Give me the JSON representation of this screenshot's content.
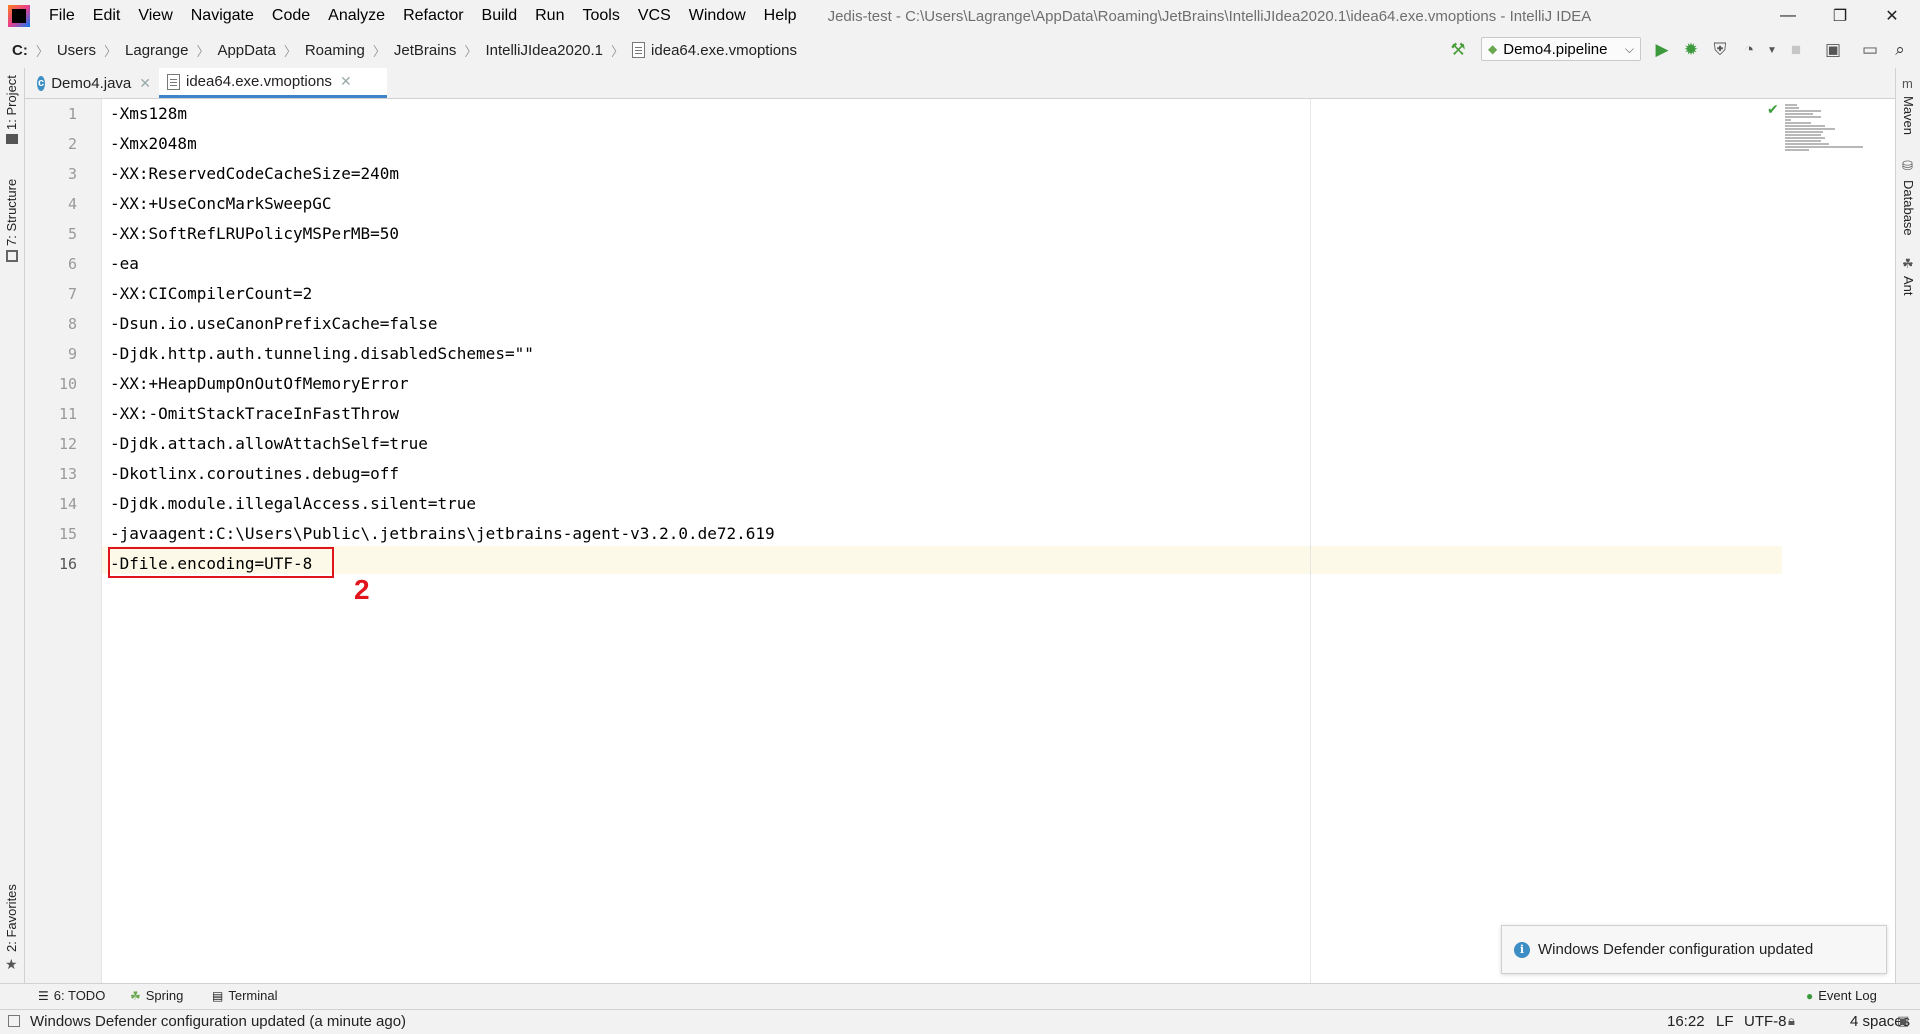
{
  "menu": {
    "items": [
      "File",
      "Edit",
      "View",
      "Navigate",
      "Code",
      "Analyze",
      "Refactor",
      "Build",
      "Run",
      "Tools",
      "VCS",
      "Window",
      "Help"
    ],
    "window_title": "Jedis-test - C:\\Users\\Lagrange\\AppData\\Roaming\\JetBrains\\IntelliJIdea2020.1\\idea64.exe.vmoptions - IntelliJ IDEA"
  },
  "breadcrumbs": [
    "C:",
    "Users",
    "Lagrange",
    "AppData",
    "Roaming",
    "JetBrains",
    "IntelliJIdea2020.1",
    "idea64.exe.vmoptions"
  ],
  "run_config": "Demo4.pipeline",
  "left_tools": [
    "1: Project",
    "7: Structure",
    "2: Favorites"
  ],
  "right_tools": [
    "Maven",
    "Database",
    "Ant"
  ],
  "tabs": [
    {
      "label": "Demo4.java",
      "icon": "java-class-icon",
      "active": false
    },
    {
      "label": "idea64.exe.vmoptions",
      "icon": "text-file-icon",
      "active": true
    }
  ],
  "editor": {
    "lines": [
      "-Xms128m",
      "-Xmx2048m",
      "-XX:ReservedCodeCacheSize=240m",
      "-XX:+UseConcMarkSweepGC",
      "-XX:SoftRefLRUPolicyMSPerMB=50",
      "-ea",
      "-XX:CICompilerCount=2",
      "-Dsun.io.useCanonPrefixCache=false",
      "-Djdk.http.auth.tunneling.disabledSchemes=\"\"",
      "-XX:+HeapDumpOnOutOfMemoryError",
      "-XX:-OmitStackTraceInFastThrow",
      "-Djdk.attach.allowAttachSelf=true",
      "-Dkotlinx.coroutines.debug=off",
      "-Djdk.module.illegalAccess.silent=true",
      "-javaagent:C:\\Users\\Public\\.jetbrains\\jetbrains-agent-v3.2.0.de72.619",
      "-Dfile.encoding=UTF-8"
    ],
    "line_numbers": [
      "1",
      "2",
      "3",
      "4",
      "5",
      "6",
      "7",
      "8",
      "9",
      "10",
      "11",
      "12",
      "13",
      "14",
      "15",
      "16"
    ],
    "annotation_number": "2"
  },
  "notification": {
    "text": "Windows Defender configuration updated"
  },
  "bottom_tools": [
    {
      "label": "6: TODO",
      "icon": "todo-icon"
    },
    {
      "label": "Spring",
      "icon": "spring-icon"
    },
    {
      "label": "Terminal",
      "icon": "terminal-icon"
    }
  ],
  "event_log": "Event Log",
  "status": {
    "message": "Windows Defender configuration updated (a minute ago)",
    "position": "16:22",
    "line_sep": "LF",
    "encoding": "UTF-8",
    "indent": "4 spaces"
  },
  "colors": {
    "accent": "#4083c9",
    "annotation": "#e2141b",
    "caret_line": "#fcf9e8"
  }
}
